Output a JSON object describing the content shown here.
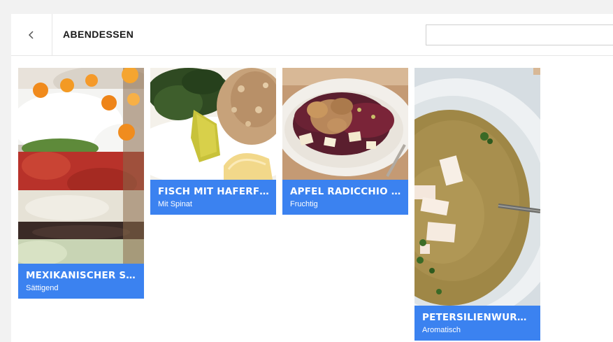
{
  "header": {
    "title": "ABENDESSEN",
    "search_placeholder": ""
  },
  "cards": [
    {
      "title": "MEXIKANISCHER SALAT",
      "subtitle": "Sättigend"
    },
    {
      "title": "FISCH MIT HAFERFLOCKEN",
      "subtitle": "Mit Spinat"
    },
    {
      "title": "APFEL RADICCHIO SALAT",
      "subtitle": "Fruchtig"
    },
    {
      "title": "PETERSILIENWURZELSUPPE",
      "subtitle": "Aromatisch"
    }
  ],
  "colors": {
    "accent": "#3b82f0",
    "background": "#f2f2f2"
  }
}
